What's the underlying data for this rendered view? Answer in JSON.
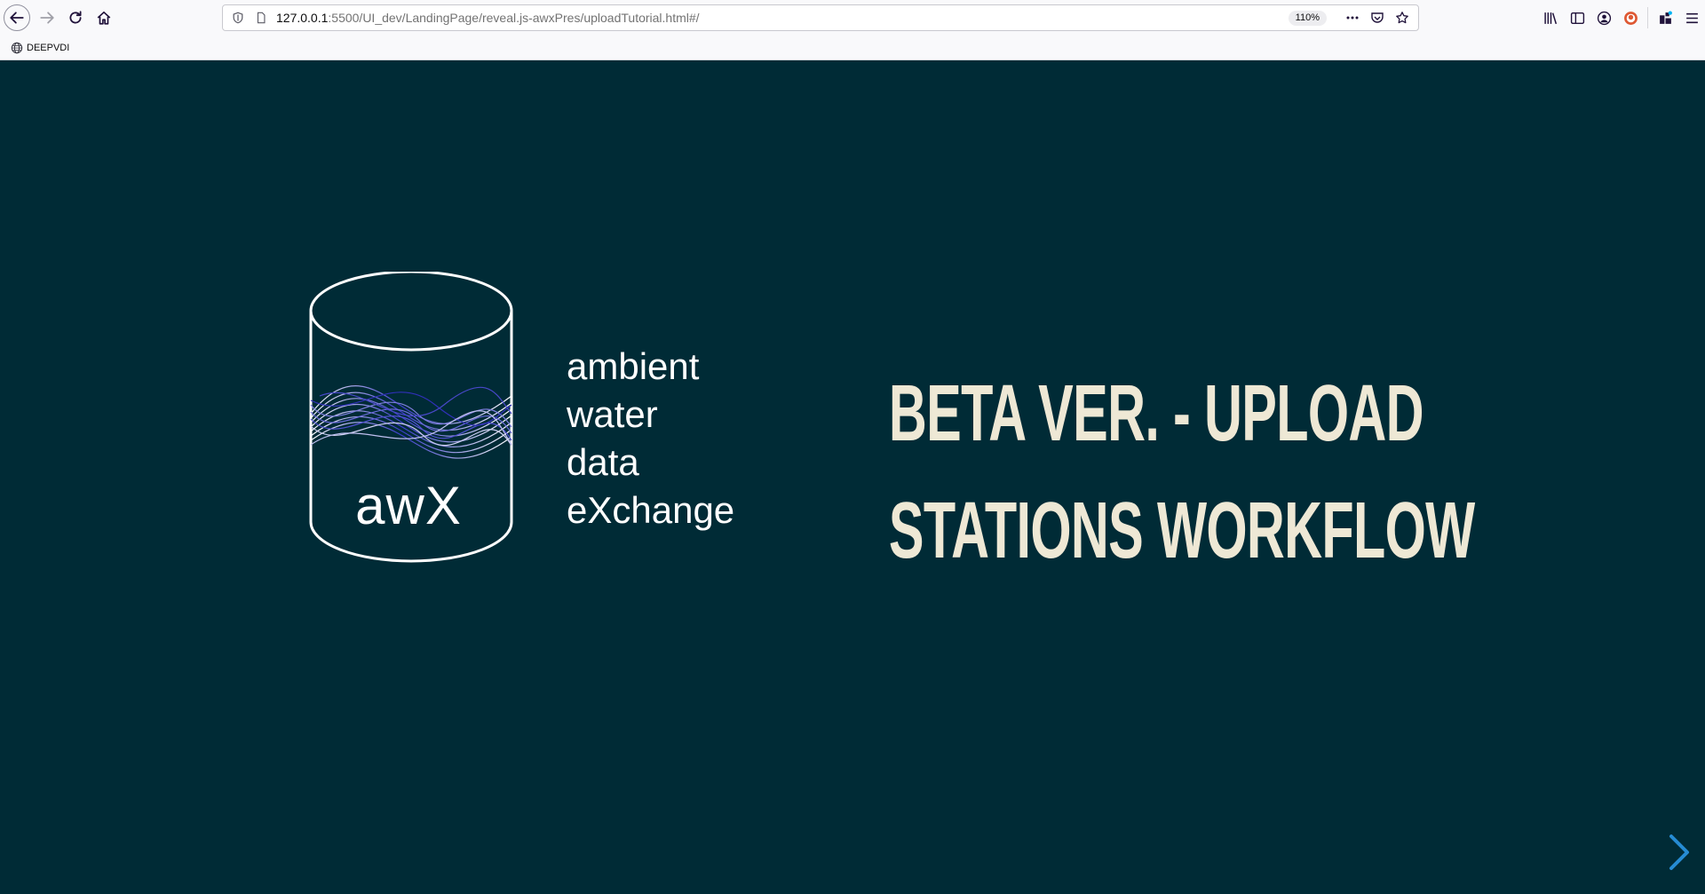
{
  "browser": {
    "url_host": "127.0.0.1",
    "url_rest": ":5500/UI_dev/LandingPage/reveal.js-awxPres/uploadTutorial.html#/",
    "zoom": "110%"
  },
  "bookmarks": [
    {
      "label": "DEEPVDI",
      "icon": "globe-icon"
    }
  ],
  "slide": {
    "logo_text": "awX",
    "tagline": [
      "ambient",
      "water",
      "data",
      "eXchange"
    ],
    "title_lines": [
      "BETA VER. - UPLOAD",
      "STATIONS WORKFLOW"
    ],
    "colors": {
      "background": "#002b36",
      "title": "#eee8d5",
      "accent": "#268bd2",
      "wave": "#4a4ad0"
    }
  }
}
